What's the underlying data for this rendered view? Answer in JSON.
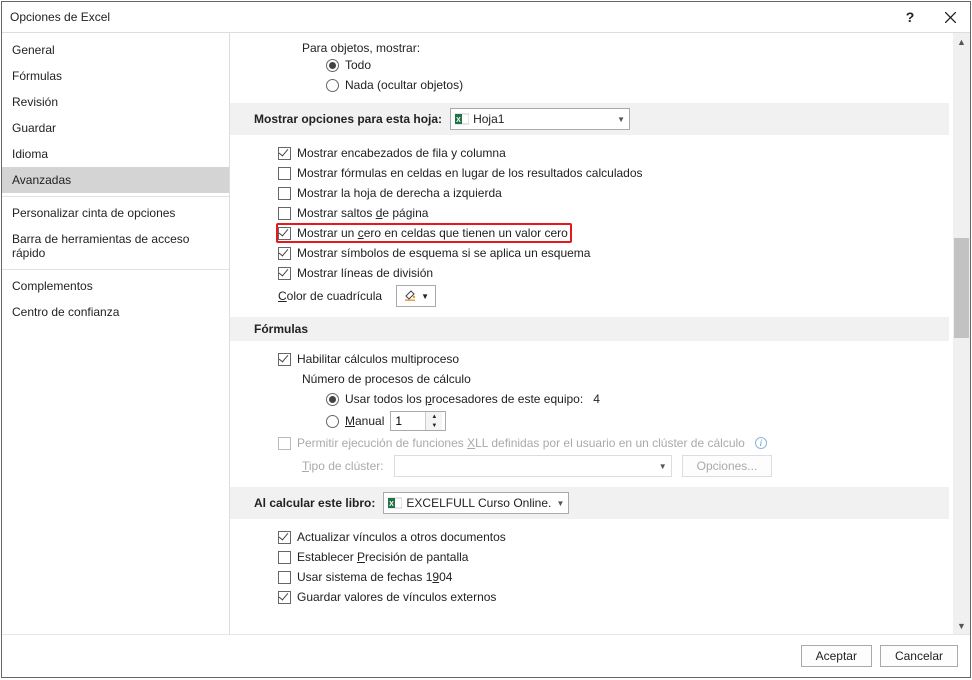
{
  "window": {
    "title": "Opciones de Excel"
  },
  "sidebar": {
    "items": [
      {
        "label": "General"
      },
      {
        "label": "Fórmulas"
      },
      {
        "label": "Revisión"
      },
      {
        "label": "Guardar"
      },
      {
        "label": "Idioma"
      },
      {
        "label": "Avanzadas",
        "selected": true
      },
      {
        "label": "Personalizar cinta de opciones"
      },
      {
        "label": "Barra de herramientas de acceso rápido"
      },
      {
        "label": "Complementos"
      },
      {
        "label": "Centro de confianza"
      }
    ]
  },
  "objects": {
    "label": "Para objetos, mostrar:",
    "opt_all": "Todo",
    "opt_none": "Nada (ocultar objetos)"
  },
  "sheet_section": {
    "title": "Mostrar opciones para esta hoja:",
    "sheet": "Hoja1",
    "row_col_headers": "Mostrar encabezados de fila y columna",
    "show_formulas": "Mostrar fórmulas en celdas en lugar de los resultados calculados",
    "rtl": "Mostrar la hoja de derecha a izquierda",
    "page_breaks_pre": "Mostrar saltos ",
    "page_breaks_u": "d",
    "page_breaks_post": "e página",
    "zero_pre": "Mostrar un ",
    "zero_u": "c",
    "zero_post": "ero en celdas que tienen un valor cero",
    "outline": "Mostrar símbolos de esquema si se aplica un esquema",
    "gridlines": "Mostrar líneas de división",
    "grid_color_u": "C",
    "grid_color_post": "olor de cuadrícula"
  },
  "formulas_section": {
    "title": "Fórmulas",
    "multithread": "Habilitar cálculos multiproceso",
    "threads_label": "Número de procesos de cálculo",
    "use_all_pre": "Usar todos los ",
    "use_all_u": "p",
    "use_all_post": "rocesadores de este equipo:",
    "count": "4",
    "manual_u": "M",
    "manual_post": "anual",
    "manual_value": "1",
    "xll_pre": "Permitir ejecución de funciones ",
    "xll_u": "X",
    "xll_post": "LL definidas por el usuario en un clúster de cálculo",
    "cluster_u": "T",
    "cluster_post": "ipo de clúster:",
    "options_btn": "Opciones..."
  },
  "calc_section": {
    "title": "Al calcular este libro:",
    "workbook": "EXCELFULL Curso Online....",
    "update_links": "Actualizar vínculos a otros documentos",
    "precision_pre": "Establecer ",
    "precision_u": "P",
    "precision_post": "recisión de pantalla",
    "date1904_pre": "Usar sistema de fechas 1",
    "date1904_u": "9",
    "date1904_post": "04",
    "save_ext": "Guardar valores de vínculos externos"
  },
  "footer": {
    "ok": "Aceptar",
    "cancel": "Cancelar"
  }
}
